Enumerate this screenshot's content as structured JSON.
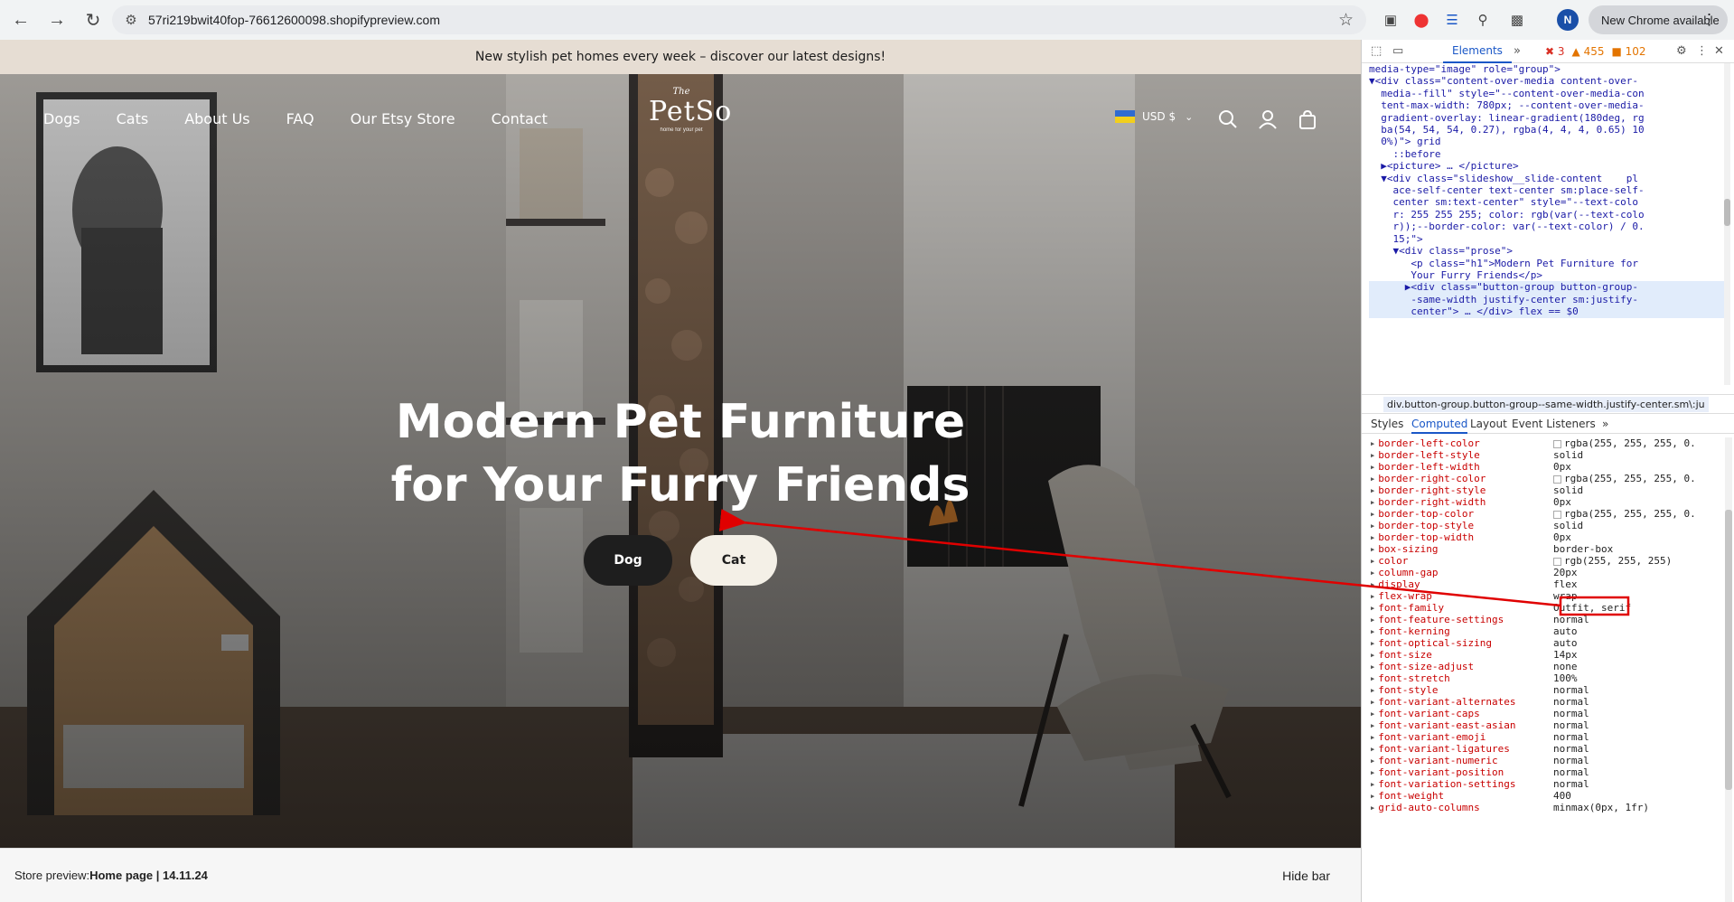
{
  "browser": {
    "url": "57ri219bwit40fop-76612600098.shopifypreview.com",
    "new_chrome_label": "New Chrome available",
    "profile_initial": "N",
    "icons": [
      "back-icon",
      "forward-icon",
      "reload-icon",
      "site-info-icon",
      "bookmark-star-icon"
    ]
  },
  "store": {
    "announcement": "New stylish pet homes every week – discover our latest designs!",
    "menu": [
      "Dogs",
      "Cats",
      "About Us",
      "FAQ",
      "Our Etsy Store",
      "Contact"
    ],
    "logo": {
      "line1": "The",
      "line2": "PetSo",
      "line3": "home for your pet"
    },
    "currency": "USD $",
    "hero_heading_line1": "Modern Pet Furniture",
    "hero_heading_line2": "for Your Furry Friends",
    "buttons": {
      "dog": "Dog",
      "cat": "Cat"
    },
    "preview_bar": {
      "prefix": "Store preview: ",
      "page": "Home page | 14.11.24",
      "hide": "Hide bar"
    }
  },
  "devtools": {
    "tab_elements": "Elements",
    "counts": {
      "errors": "3",
      "warnings": "455",
      "issues": "102"
    },
    "dom_lines": [
      "media-type=\"image\" role=\"group\">",
      "▼<div class=\"content-over-media content-over-",
      "  media--fill\" style=\"--content-over-media-con",
      "  tent-max-width: 780px; --content-over-media-",
      "  gradient-overlay: linear-gradient(180deg, rg",
      "  ba(54, 54, 54, 0.27), rgba(4, 4, 4, 0.65) 10",
      "  0%)\"> grid",
      "    ::before",
      "  ▶<picture> … </picture>",
      "  ▼<div class=\"slideshow__slide-content    pl",
      "    ace-self-center text-center sm:place-self-",
      "    center sm:text-center\" style=\"--text-colo",
      "    r: 255 255 255; color: rgb(var(--text-colo",
      "    r));--border-color: var(--text-color) / 0.",
      "    15;\">",
      "    ▼<div class=\"prose\">",
      "       <p class=\"h1\">Modern Pet Furniture for",
      "       Your Furry Friends</p>",
      "      ▶<div class=\"button-group button-group-",
      "       -same-width justify-center sm:justify-",
      "       center\"> … </div> flex == $0"
    ],
    "breadcrumb": "div.button-group.button-group--same-width.justify-center.sm\\:ju",
    "subtabs": [
      "Styles",
      "Computed",
      "Layout",
      "Event Listeners"
    ],
    "computed": [
      {
        "name": "border-left-color",
        "value": "rgba(255, 255, 255, 0.",
        "swatch": true
      },
      {
        "name": "border-left-style",
        "value": "solid"
      },
      {
        "name": "border-left-width",
        "value": "0px"
      },
      {
        "name": "border-right-color",
        "value": "rgba(255, 255, 255, 0.",
        "swatch": true
      },
      {
        "name": "border-right-style",
        "value": "solid"
      },
      {
        "name": "border-right-width",
        "value": "0px"
      },
      {
        "name": "border-top-color",
        "value": "rgba(255, 255, 255, 0.",
        "swatch": true
      },
      {
        "name": "border-top-style",
        "value": "solid"
      },
      {
        "name": "border-top-width",
        "value": "0px"
      },
      {
        "name": "box-sizing",
        "value": "border-box"
      },
      {
        "name": "color",
        "value": "rgb(255, 255, 255)",
        "swatch": true
      },
      {
        "name": "column-gap",
        "value": "20px"
      },
      {
        "name": "display",
        "value": "flex"
      },
      {
        "name": "flex-wrap",
        "value": "wrap"
      },
      {
        "name": "font-family",
        "value": "Outfit, serif"
      },
      {
        "name": "font-feature-settings",
        "value": "normal"
      },
      {
        "name": "font-kerning",
        "value": "auto"
      },
      {
        "name": "font-optical-sizing",
        "value": "auto"
      },
      {
        "name": "font-size",
        "value": "14px"
      },
      {
        "name": "font-size-adjust",
        "value": "none"
      },
      {
        "name": "font-stretch",
        "value": "100%"
      },
      {
        "name": "font-style",
        "value": "normal"
      },
      {
        "name": "font-variant-alternates",
        "value": "normal"
      },
      {
        "name": "font-variant-caps",
        "value": "normal"
      },
      {
        "name": "font-variant-east-asian",
        "value": "normal"
      },
      {
        "name": "font-variant-emoji",
        "value": "normal"
      },
      {
        "name": "font-variant-ligatures",
        "value": "normal"
      },
      {
        "name": "font-variant-numeric",
        "value": "normal"
      },
      {
        "name": "font-variant-position",
        "value": "normal"
      },
      {
        "name": "font-variation-settings",
        "value": "normal"
      },
      {
        "name": "font-weight",
        "value": "400"
      },
      {
        "name": "grid-auto-columns",
        "value": "minmax(0px, 1fr)"
      }
    ]
  },
  "colors": {
    "annotation_red": "#e00000",
    "dog_button": "#1e1e1e",
    "cat_button": "#f4f0e7",
    "announcement_bg": "#e6ddd3"
  }
}
